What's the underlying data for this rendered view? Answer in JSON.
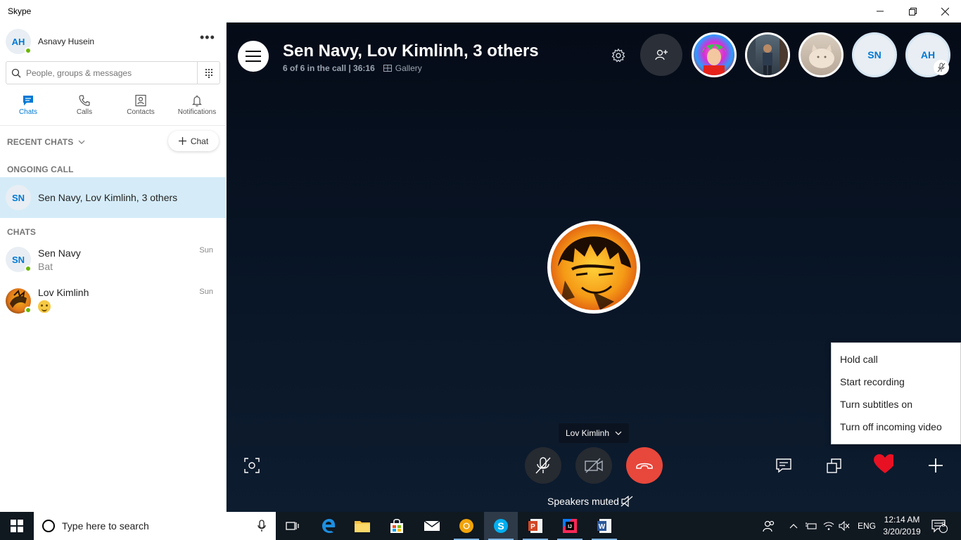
{
  "window": {
    "title": "Skype",
    "controls": [
      "minimize",
      "restore",
      "close"
    ]
  },
  "profile": {
    "initials": "AH",
    "name": "Asnavy Husein",
    "status": "online"
  },
  "search": {
    "placeholder": "People, groups & messages"
  },
  "nav_tabs": [
    {
      "label": "Chats",
      "icon": "chat-icon",
      "active": true
    },
    {
      "label": "Calls",
      "icon": "phone-icon",
      "active": false
    },
    {
      "label": "Contacts",
      "icon": "contacts-icon",
      "active": false
    },
    {
      "label": "Notifications",
      "icon": "bell-icon",
      "active": false
    }
  ],
  "recent_chats_label": "RECENT CHATS",
  "new_chat_label": "Chat",
  "ongoing_call_label": "ONGOING CALL",
  "ongoing_call": {
    "initials": "SN",
    "name": "Sen Navy, Lov Kimlinh, 3 others"
  },
  "chats_label": "CHATS",
  "chats": [
    {
      "initials": "SN",
      "name": "Sen Navy",
      "preview": "Bat",
      "time": "Sun",
      "online": true
    },
    {
      "initials": "",
      "name": "Lov Kimlinh",
      "preview": "emoji",
      "time": "Sun",
      "online": true
    }
  ],
  "call": {
    "title": "Sen Navy, Lov Kimlinh, 3 others",
    "status": "6 of 6 in the call | 36:16",
    "separator": "|",
    "view_mode": "Gallery",
    "participants": [
      {
        "type": "photo",
        "label": "colorful-hair-avatar"
      },
      {
        "type": "photo",
        "label": "man-photo-avatar"
      },
      {
        "type": "photo",
        "label": "cat-photo-avatar"
      },
      {
        "type": "initials",
        "label": "SN"
      },
      {
        "type": "initials",
        "label": "AH",
        "muted": true
      }
    ],
    "speaker_name": "Lov Kimlinh",
    "speakers_status": "Speakers muted"
  },
  "more_menu": [
    "Hold call",
    "Start recording",
    "Turn subtitles on",
    "Turn off incoming video"
  ],
  "taskbar": {
    "search_placeholder": "Type here to search",
    "language": "ENG",
    "time": "12:14 AM",
    "date": "3/20/2019",
    "notification_count": "8"
  },
  "colors": {
    "accent": "#0078d4",
    "hangup": "#e8473b",
    "ongoing_highlight": "#d5ecf8",
    "heart": "#e81123",
    "call_bg": "#091627"
  }
}
